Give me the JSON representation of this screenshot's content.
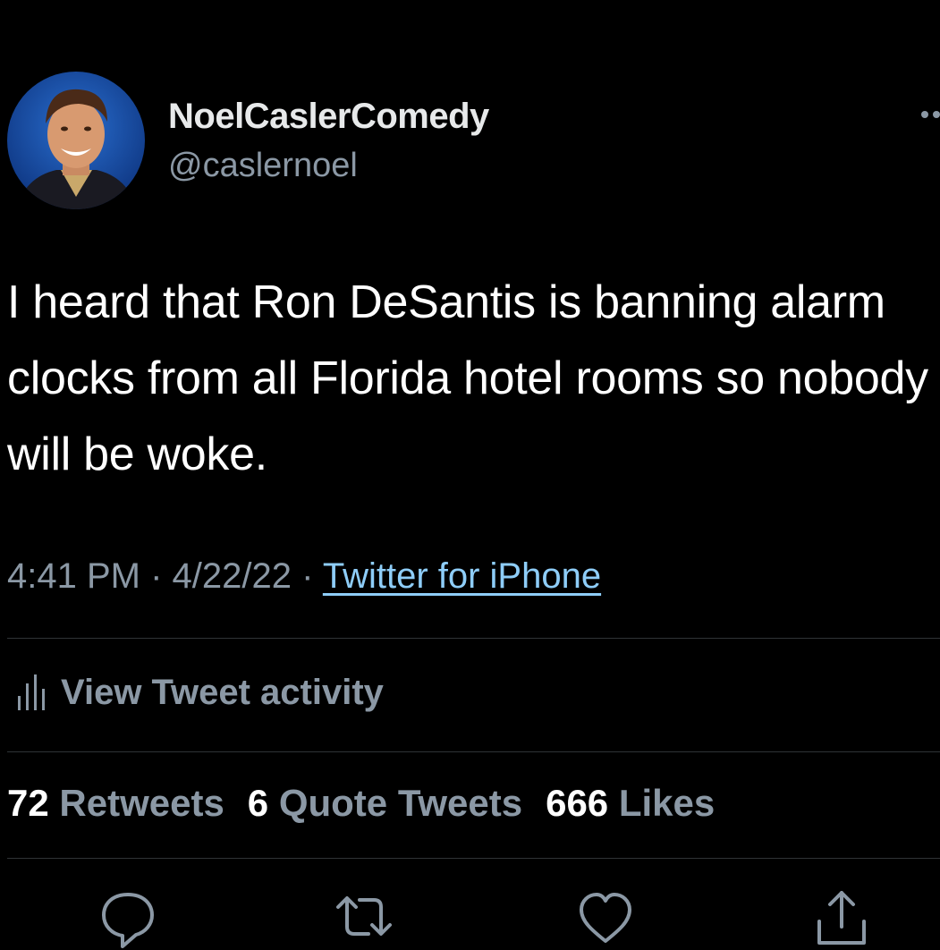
{
  "user": {
    "display_name": "NoelCaslerComedy",
    "handle": "@caslernoel"
  },
  "tweet": {
    "text": "I heard that Ron DeSantis is banning alarm clocks from all Florida hotel rooms so nobody will be woke.",
    "time": "4:41 PM",
    "date": "4/22/22",
    "source": "Twitter for iPhone"
  },
  "activity": {
    "label": "View Tweet activity"
  },
  "stats": {
    "retweets_count": "72",
    "retweets_label": "Retweets",
    "quotes_count": "6",
    "quotes_label": "Quote Tweets",
    "likes_count": "666",
    "likes_label": "Likes"
  },
  "icons": {
    "activity": "bar-chart-icon",
    "reply": "reply-icon",
    "retweet": "retweet-icon",
    "like": "heart-icon",
    "share": "share-icon",
    "more": "more-icon"
  },
  "colors": {
    "background": "#000000",
    "text_primary": "#ffffff",
    "text_secondary": "#8b98a5",
    "link": "#8ecdf8",
    "divider": "#2f3336"
  }
}
